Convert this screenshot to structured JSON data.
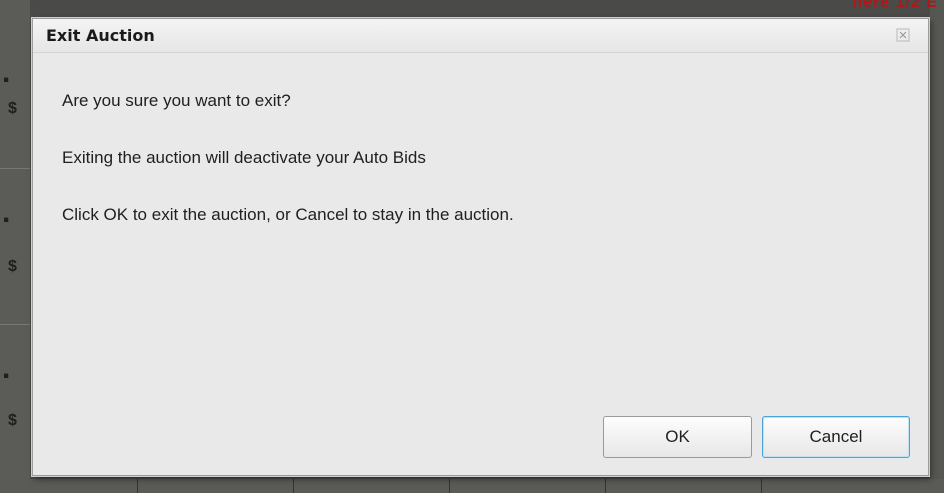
{
  "background": {
    "red_text": "nere 1/2 E"
  },
  "dialog": {
    "title": "Exit Auction",
    "close_glyph": "close-icon",
    "messages": [
      "Are you sure you want to exit?",
      "Exiting the auction will deactivate your Auto Bids",
      "Click OK to exit the auction, or Cancel to stay in the auction."
    ],
    "ok_label": "OK",
    "cancel_label": "Cancel"
  },
  "colors": {
    "dialog_bg": "#e9e9e9",
    "focus_border": "#4aa3da",
    "background_red_text": "#b01818"
  }
}
